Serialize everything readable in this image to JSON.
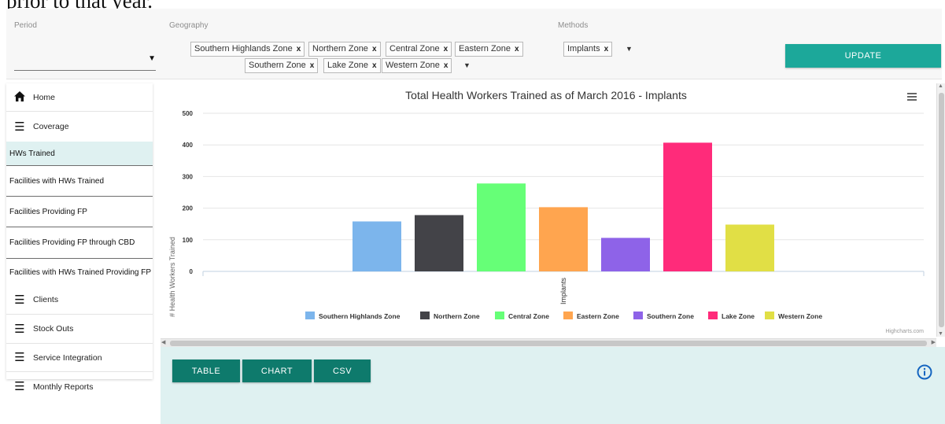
{
  "page": {
    "top_caption": "prior to that year."
  },
  "filters": {
    "period": {
      "label": "Period",
      "value": ""
    },
    "geography": {
      "label": "Geography",
      "chips": [
        "Southern Highlands Zone",
        "Northern Zone",
        "Central Zone",
        "Eastern Zone",
        "Southern Zone",
        "Lake Zone",
        "Western Zone"
      ],
      "remove_glyph": "x"
    },
    "methods": {
      "label": "Methods",
      "chips": [
        "Implants"
      ]
    },
    "update_label": "UPDATE"
  },
  "sidebar": {
    "home": {
      "label": "Home",
      "icon": "home-icon"
    },
    "coverage": {
      "label": "Coverage",
      "icon": "list-icon"
    },
    "sub_items": [
      {
        "label": "HWs Trained",
        "active": true
      },
      {
        "label": "Facilities with HWs Trained",
        "active": false
      },
      {
        "label": "Facilities Providing FP",
        "active": false
      },
      {
        "label": "Facilities Providing FP through CBD",
        "active": false
      },
      {
        "label": "Facilities with HWs Trained Providing FP",
        "active": false
      }
    ],
    "sections": [
      {
        "label": "Clients",
        "icon": "list-icon"
      },
      {
        "label": "Stock Outs",
        "icon": "list-icon"
      },
      {
        "label": "Service Integration",
        "icon": "list-icon"
      },
      {
        "label": "Monthly Reports",
        "icon": "list-icon"
      }
    ]
  },
  "chart_data": {
    "type": "bar",
    "title": "Total Health Workers Trained as of March 2016 - Implants",
    "xlabel": "",
    "ylabel": "# Health Workers Trained",
    "categories": [
      "Implants"
    ],
    "ylim": [
      0,
      500
    ],
    "yticks": [
      0,
      100,
      200,
      300,
      400,
      500
    ],
    "grid": true,
    "legend_position": "bottom",
    "series": [
      {
        "name": "Southern Highlands Zone",
        "values": [
          158
        ],
        "color": "#7cb5ec"
      },
      {
        "name": "Northern Zone",
        "values": [
          178
        ],
        "color": "#434348"
      },
      {
        "name": "Central Zone",
        "values": [
          278
        ],
        "color": "#66ff77"
      },
      {
        "name": "Eastern Zone",
        "values": [
          203
        ],
        "color": "#ffa54f"
      },
      {
        "name": "Southern Zone",
        "values": [
          106
        ],
        "color": "#8e63e8"
      },
      {
        "name": "Lake Zone",
        "values": [
          407
        ],
        "color": "#ff2b7a"
      },
      {
        "name": "Western Zone",
        "values": [
          148
        ],
        "color": "#e1df45"
      }
    ],
    "credits": "Highcharts.com"
  },
  "actions": {
    "table_label": "TABLE",
    "chart_label": "CHART",
    "csv_label": "CSV"
  },
  "colors": {
    "accent": "#1ca89a",
    "action": "#0e7a6c",
    "panel": "#dff1f1",
    "info": "#1565c0"
  }
}
